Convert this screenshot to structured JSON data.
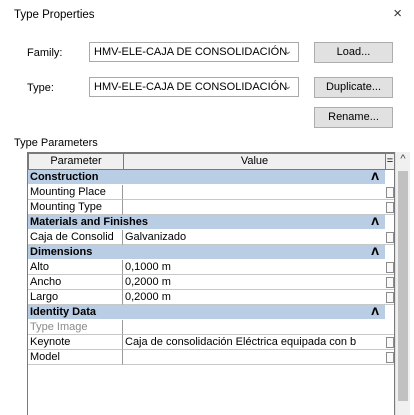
{
  "dialog": {
    "title": "Type Properties",
    "close_glyph": "×"
  },
  "family": {
    "label": "Family:",
    "value": "HMV-ELE-CAJA DE CONSOLIDACIÓN"
  },
  "type": {
    "label": "Type:",
    "value": "HMV-ELE-CAJA DE CONSOLIDACIÓN"
  },
  "buttons": {
    "load": "Load...",
    "duplicate": "Duplicate...",
    "rename": "Rename..."
  },
  "section_label": "Type Parameters",
  "grid": {
    "col_parameter": "Parameter",
    "col_value": "Value",
    "col_eq": "=",
    "groups": [
      {
        "name": "Construction",
        "caret": "ᐱ",
        "rows": [
          {
            "param": "Mounting Place",
            "value": ""
          },
          {
            "param": "Mounting Type",
            "value": ""
          }
        ]
      },
      {
        "name": "Materials and Finishes",
        "caret": "ᐱ",
        "rows": [
          {
            "param": "Caja de Consolid",
            "value": "Galvanizado"
          }
        ]
      },
      {
        "name": "Dimensions",
        "caret": "ᐱ",
        "rows": [
          {
            "param": "Alto",
            "value": "0,1000 m"
          },
          {
            "param": "Ancho",
            "value": "0,2000 m"
          },
          {
            "param": "Largo",
            "value": "0,2000 m"
          }
        ]
      },
      {
        "name": "Identity Data",
        "caret": "ᐱ",
        "rows": [
          {
            "param": "Type Image",
            "value": ""
          },
          {
            "param": "Keynote",
            "value": "Caja de consolidación Eléctrica equipada con b"
          },
          {
            "param": "Model",
            "value": ""
          }
        ]
      }
    ]
  },
  "scrollbar": {
    "up_glyph": "^"
  }
}
